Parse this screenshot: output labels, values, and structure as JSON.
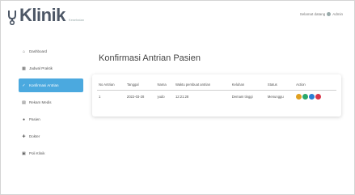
{
  "app": {
    "logo_text": "Klinik",
    "logo_sub": "Kesehatan"
  },
  "user": {
    "label": "Selamat datang",
    "name": "Admin"
  },
  "sidebar": {
    "items": [
      {
        "label": "Dashboard",
        "icon": "home-icon"
      },
      {
        "label": "Jadwal Praktik",
        "icon": "calendar-icon"
      },
      {
        "label": "Konfirmasi Antrian",
        "icon": "check-icon",
        "active": true
      },
      {
        "label": "Rekam Medis",
        "icon": "file-icon"
      },
      {
        "label": "Pasien",
        "icon": "user-icon"
      },
      {
        "label": "Dokter",
        "icon": "doctor-icon"
      },
      {
        "label": "Poli Klinik",
        "icon": "clinic-icon"
      }
    ]
  },
  "main": {
    "title": "Konfirmasi Antrian Pasien"
  },
  "table": {
    "headers": [
      "No Antrian",
      "Tanggal",
      "Nama",
      "Waktu pembuat antrian",
      "Keluhan",
      "Status",
      "Action"
    ],
    "rows": [
      [
        "1",
        "2022-03-28",
        "yudo",
        "12:21:28",
        "Demam tinggi",
        "Menunggu"
      ]
    ]
  },
  "colors": {
    "accent": "#4ba9df",
    "action_buttons": [
      "#e0a020",
      "#2aa86a",
      "#2b7fd4",
      "#d8364a"
    ]
  }
}
